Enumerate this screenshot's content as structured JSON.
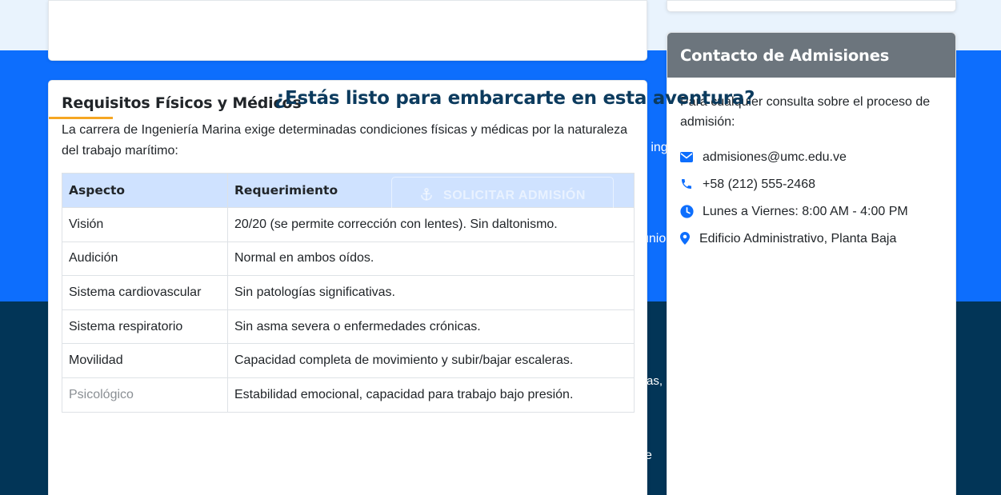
{
  "background": {
    "bleed_texts": [
      "e ing",
      "unio",
      "as,",
      ".",
      "e"
    ]
  },
  "cta": {
    "title": "¿Estás listo para embarcarte en esta aventura?",
    "button_label": "SOLICITAR ADMISIÓN",
    "button_icon": "anchor-icon"
  },
  "requirements": {
    "title": "Requisitos Físicos y Médicos",
    "intro": "La carrera de Ingeniería Marina exige determinadas condiciones físicas y médicas por la naturaleza del trabajo marítimo:",
    "headers": [
      "Aspecto",
      "Requerimiento"
    ],
    "rows": [
      [
        "Visión",
        "20/20 (se permite corrección con lentes). Sin daltonismo."
      ],
      [
        "Audición",
        "Normal en ambos oídos."
      ],
      [
        "Sistema cardiovascular",
        "Sin patologías significativas."
      ],
      [
        "Sistema respiratorio",
        "Sin asma severa o enfermedades crónicas."
      ],
      [
        "Movilidad",
        "Capacidad completa de movimiento y subir/bajar escaleras."
      ],
      [
        "Psicológico",
        "Estabilidad emocional, capacidad para trabajo bajo presión."
      ]
    ]
  },
  "contact": {
    "title": "Contacto de Admisiones",
    "intro": "Para cualquier consulta sobre el proceso de admisión:",
    "items": [
      {
        "icon": "envelope-icon",
        "text": "admisiones@umc.edu.ve"
      },
      {
        "icon": "phone-icon",
        "text": "+58 (212) 555-2468"
      },
      {
        "icon": "clock-icon",
        "text": "Lunes a Viernes: 8:00 AM - 4:00 PM"
      },
      {
        "icon": "map-marker-icon",
        "text": "Edificio Administrativo, Planta Baja"
      }
    ]
  },
  "colors": {
    "accent_blue": "#0d6efd",
    "navy": "#023557",
    "header_gray": "#6c757d",
    "table_header": "#cfe2ff",
    "underline_orange": "#f5a623",
    "cta_title": "#0c3b5e"
  }
}
